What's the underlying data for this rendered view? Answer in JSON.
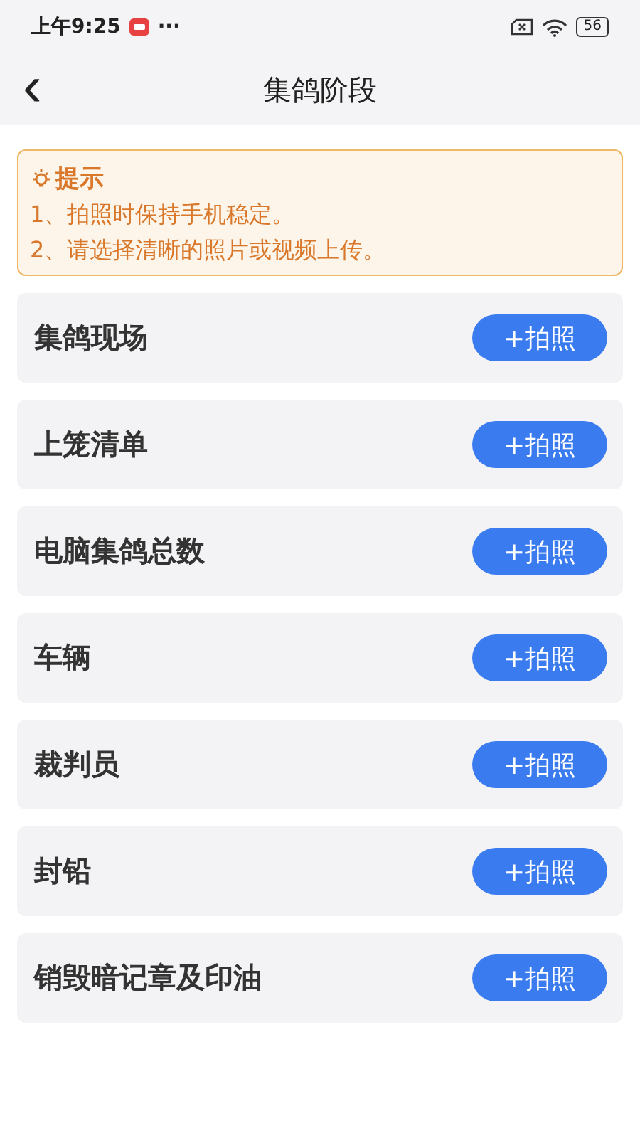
{
  "status_bar": {
    "time": "上午9:25",
    "more": "···",
    "battery": "56"
  },
  "header": {
    "back": "‹",
    "title": "集鸽阶段"
  },
  "tip": {
    "title": "提示",
    "lines": [
      "1、拍照时保持手机稳定。",
      "2、请选择清晰的照片或视频上传。"
    ]
  },
  "items": [
    {
      "label": "集鸽现场",
      "button": "+拍照"
    },
    {
      "label": "上笼清单",
      "button": "+拍照"
    },
    {
      "label": "电脑集鸽总数",
      "button": "+拍照"
    },
    {
      "label": "车辆",
      "button": "+拍照"
    },
    {
      "label": "裁判员",
      "button": "+拍照"
    },
    {
      "label": "封铅",
      "button": "+拍照"
    },
    {
      "label": "销毁暗记章及印油",
      "button": "+拍照"
    }
  ]
}
